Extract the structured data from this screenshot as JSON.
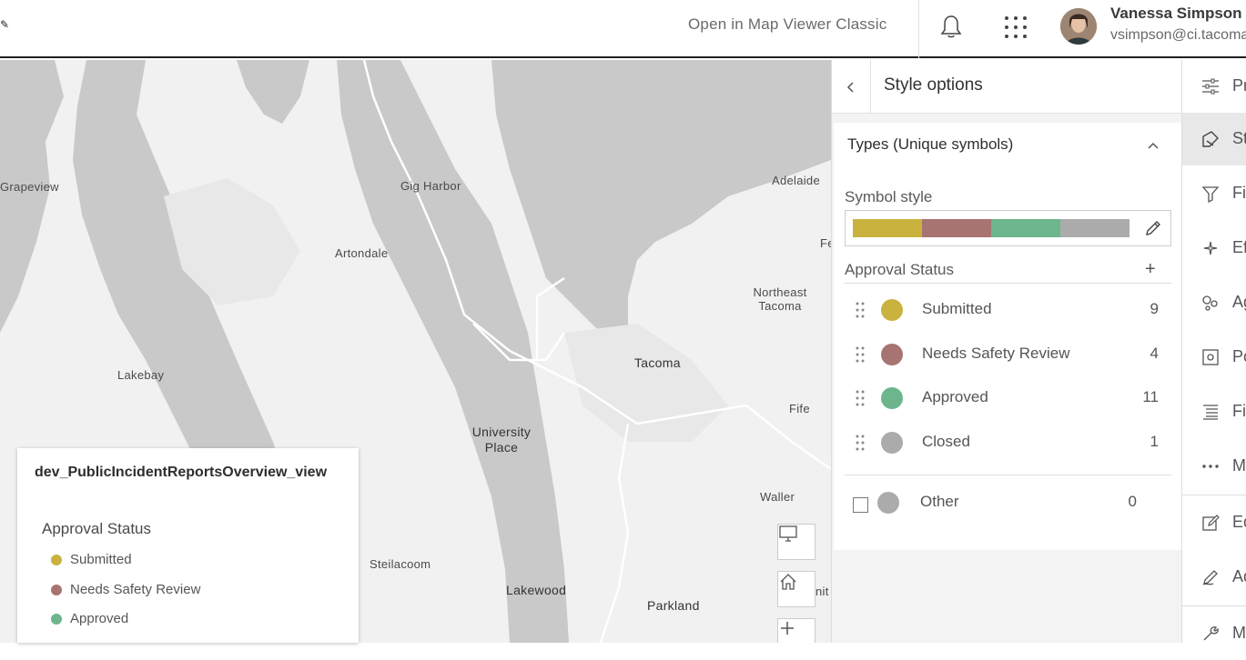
{
  "header": {
    "open_classic": "Open in Map Viewer Classic",
    "user_name": "Vanessa Simpson",
    "user_email": "vsimpson@ci.tacoma"
  },
  "map": {
    "labels": {
      "grapeview": "Grapeview",
      "gig_harbor": "Gig Harbor",
      "adelaide": "Adelaide",
      "artondale": "Artondale",
      "fe": "Fe",
      "northeast_tacoma": "Northeast Tacoma",
      "tacoma": "Tacoma",
      "lakebay": "Lakebay",
      "fife": "Fife",
      "university_place": "University Place",
      "waller": "Waller",
      "steilacoom": "Steilacoom",
      "lakewood": "Lakewood",
      "parkland": "Parkland",
      "nit": "nit"
    }
  },
  "legend": {
    "layer_title": "dev_PublicIncidentReportsOverview_view",
    "field": "Approval Status",
    "items": [
      {
        "label": "Submitted",
        "color": "#c9b33e"
      },
      {
        "label": "Needs Safety Review",
        "color": "#a77471"
      },
      {
        "label": "Approved",
        "color": "#6db58c"
      }
    ]
  },
  "panel": {
    "title": "Style options",
    "section": "Types (Unique symbols)",
    "symbol_style": "Symbol style",
    "field": "Approval Status",
    "ramp_colors": [
      "#c9b33e",
      "#a77471",
      "#6db58c",
      "#ababab"
    ],
    "categories": [
      {
        "label": "Submitted",
        "count": "9",
        "color": "#c9b33e"
      },
      {
        "label": "Needs Safety Review",
        "count": "4",
        "color": "#a77471"
      },
      {
        "label": "Approved",
        "count": "11",
        "color": "#6db58c"
      },
      {
        "label": "Closed",
        "count": "1",
        "color": "#ababab"
      }
    ],
    "other": {
      "label": "Other",
      "count": "0",
      "color": "#ababab"
    }
  },
  "strip": {
    "tools": [
      "Pr",
      "St",
      "Fi",
      "Ef",
      "Ag",
      "Po",
      "Fi",
      "M",
      "Ed",
      "Ad",
      "M"
    ]
  }
}
